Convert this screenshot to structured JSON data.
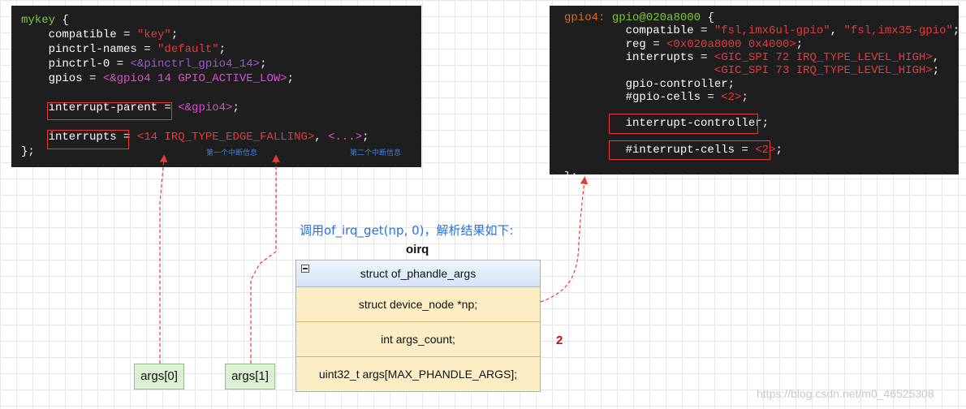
{
  "left_code": {
    "lines": [
      [
        {
          "t": "mykey",
          "c": "k"
        },
        {
          "t": " {",
          "c": ""
        }
      ],
      [
        {
          "t": "    compatible = ",
          "c": ""
        },
        {
          "t": "\"key\"",
          "c": "s"
        },
        {
          "t": ";",
          "c": ""
        }
      ],
      [
        {
          "t": "    pinctrl-names = ",
          "c": ""
        },
        {
          "t": "\"default\"",
          "c": "s"
        },
        {
          "t": ";",
          "c": ""
        }
      ],
      [
        {
          "t": "    pinctrl-0 = ",
          "c": ""
        },
        {
          "t": "<&pinctrl_gpio4_14>",
          "c": "pl"
        },
        {
          "t": ";",
          "c": ""
        }
      ],
      [
        {
          "t": "    gpios = ",
          "c": ""
        },
        {
          "t": "<&gpio4 14 GPIO_ACTIVE_LOW>",
          "c": "p"
        },
        {
          "t": ";",
          "c": ""
        }
      ],
      [
        {
          "t": "",
          "c": ""
        }
      ],
      [
        {
          "t": "    interrupt-parent",
          "c": ""
        },
        {
          "t": " = ",
          "c": ""
        },
        {
          "t": "<&gpio4>",
          "c": "p"
        },
        {
          "t": ";",
          "c": ""
        }
      ],
      [
        {
          "t": "",
          "c": ""
        }
      ],
      [
        {
          "t": "    interrupts",
          "c": ""
        },
        {
          "t": " = ",
          "c": ""
        },
        {
          "t": "<14 IRQ_TYPE_EDGE_FALLING>",
          "c": "s"
        },
        {
          "t": ", ",
          "c": ""
        },
        {
          "t": "<...>",
          "c": "p"
        },
        {
          "t": ";",
          "c": ""
        }
      ],
      [
        {
          "t": "};",
          "c": ""
        }
      ]
    ],
    "note_first": "第一个中断信息",
    "note_second": "第二个中断信息"
  },
  "right_code": {
    "lines": [
      [
        {
          "t": "gpio4",
          "c": "o"
        },
        {
          "t": ": ",
          "c": "o"
        },
        {
          "t": "gpio@020a8000",
          "c": "k"
        },
        {
          "t": " {",
          "c": ""
        }
      ],
      [
        {
          "t": "         compatible = ",
          "c": ""
        },
        {
          "t": "\"fsl,imx6ul-gpio\"",
          "c": "s"
        },
        {
          "t": ", ",
          "c": ""
        },
        {
          "t": "\"fsl,imx35-gpio\"",
          "c": "s"
        },
        {
          "t": ";",
          "c": ""
        }
      ],
      [
        {
          "t": "         reg = ",
          "c": ""
        },
        {
          "t": "<0x020a8000 0x4000>",
          "c": "s"
        },
        {
          "t": ";",
          "c": ""
        }
      ],
      [
        {
          "t": "         interrupts = ",
          "c": ""
        },
        {
          "t": "<GIC_SPI 72 IRQ_TYPE_LEVEL_HIGH>",
          "c": "s"
        },
        {
          "t": ",",
          "c": ""
        }
      ],
      [
        {
          "t": "                      ",
          "c": ""
        },
        {
          "t": "<GIC_SPI 73 IRQ_TYPE_LEVEL_HIGH>",
          "c": "s"
        },
        {
          "t": ";",
          "c": ""
        }
      ],
      [
        {
          "t": "         gpio-controller;",
          "c": ""
        }
      ],
      [
        {
          "t": "         #gpio-cells = ",
          "c": ""
        },
        {
          "t": "<2>",
          "c": "s"
        },
        {
          "t": ";",
          "c": ""
        }
      ],
      [
        {
          "t": "",
          "c": ""
        }
      ],
      [
        {
          "t": "         interrupt-controller;",
          "c": ""
        }
      ],
      [
        {
          "t": "",
          "c": ""
        }
      ],
      [
        {
          "t": "         #interrupt-cells = ",
          "c": ""
        },
        {
          "t": "<2>",
          "c": "s"
        },
        {
          "t": ";",
          "c": ""
        }
      ],
      [
        {
          "t": "",
          "c": ""
        }
      ],
      [
        {
          "t": "};",
          "c": ""
        }
      ]
    ]
  },
  "caption": "调用of_irq_get(np, 0)，解析结果如下:",
  "struct_title": "oirq",
  "struct": {
    "header": "struct of_phandle_args",
    "fields": [
      "struct device_node *np;",
      "int args_count;",
      "uint32_t args[MAX_PHANDLE_ARGS];"
    ]
  },
  "args_count_value": "2",
  "arg_boxes": [
    "args[0]",
    "args[1]"
  ],
  "watermark": "https://blog.csdn.net/m0_46525308",
  "colors": {
    "code_bg": "#1e1e1e",
    "highlight_box": "#e53935",
    "connector": "#e53935",
    "struct_field_bg": "#fdedc4",
    "arg_box_bg": "#dcf0d4"
  }
}
